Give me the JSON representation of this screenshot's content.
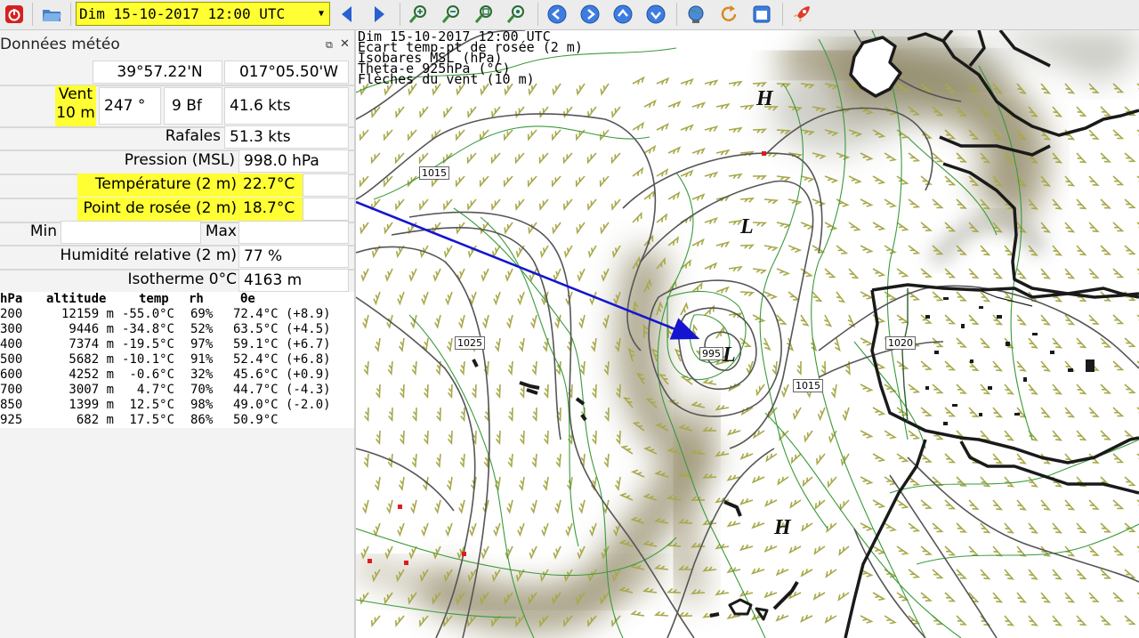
{
  "toolbar": {
    "date_value": "Dim 15-10-2017 12:00 UTC"
  },
  "panel": {
    "title": "Données météo",
    "lat": "39°57.22'N",
    "lon": "017°05.50'W",
    "wind_label_1": "Vent",
    "wind_label_2": "10 m",
    "wind_dir": "247 °",
    "wind_bf": "9 Bf",
    "wind_kts": "41.6  kts",
    "gust_label": "Rafales",
    "gust_value": "51.3  kts",
    "pressure_label": "Pression (MSL)",
    "pressure_value": "998.0 hPa",
    "temp_label": "Température (2 m)",
    "temp_value": "22.7°C",
    "dew_label": "Point de rosée (2 m)",
    "dew_value": "18.7°C",
    "min_label": "Min",
    "max_label": "Max",
    "humidity_label": "Humidité relative (2 m)",
    "humidity_value": "77 %",
    "iso_label": "Isotherme 0°C",
    "iso_value": "4163 m"
  },
  "sounding": {
    "headers": [
      "hPa",
      "altitude",
      "temp",
      "rh",
      "θe"
    ],
    "rows": [
      [
        "200",
        "12159 m",
        "-55.0°C",
        "69%",
        "72.4°C (+8.9)"
      ],
      [
        "300",
        "9446 m",
        "-34.8°C",
        "52%",
        "63.5°C (+4.5)"
      ],
      [
        "400",
        "7374 m",
        "-19.5°C",
        "97%",
        "59.1°C (+6.7)"
      ],
      [
        "500",
        "5682 m",
        "-10.1°C",
        "91%",
        "52.4°C (+6.8)"
      ],
      [
        "600",
        "4252 m",
        "-0.6°C",
        "32%",
        "45.6°C (+0.9)"
      ],
      [
        "700",
        "3007 m",
        "4.7°C",
        "70%",
        "44.7°C (-4.3)"
      ],
      [
        "850",
        "1399 m",
        "12.5°C",
        "98%",
        "49.0°C (-2.0)"
      ],
      [
        "925",
        "682 m",
        "17.5°C",
        "86%",
        "50.9°C"
      ]
    ]
  },
  "map": {
    "title_lines": [
      "Dim 15-10-2017 12:00 UTC",
      "Ecart temp-pt de rosée (2 m)",
      "Isobares MSL (hPa)",
      "Theta-e 925hPa (°C)",
      "Flèches du vent (10 m)"
    ],
    "pressure_centers": [
      "H",
      "L",
      "L",
      "H"
    ],
    "isobar_labels": [
      "1015",
      "1025",
      "995",
      "1015",
      "1020"
    ]
  },
  "colors": {
    "highlight": "#ffff33",
    "arrow": "#1515d0",
    "barb": "#a8a84a",
    "theta": "#3a9a3a",
    "isobar": "#555555"
  }
}
